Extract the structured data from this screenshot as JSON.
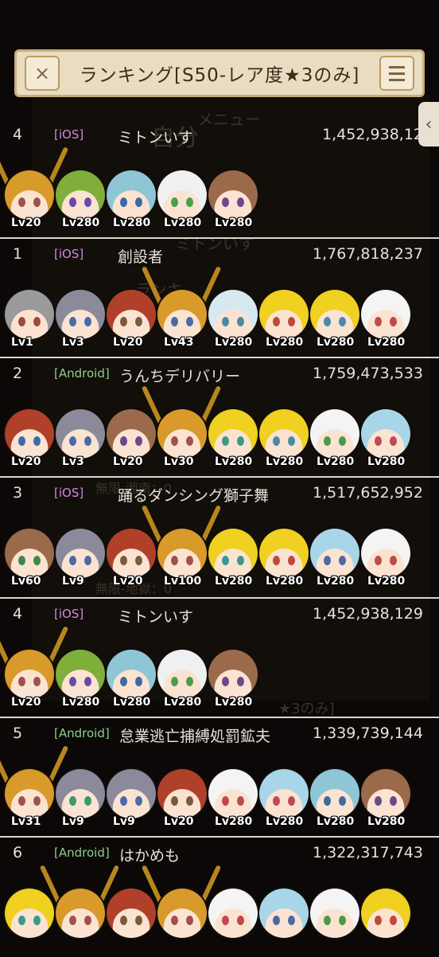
{
  "header": {
    "title": "ランキング[S50-レア度★3のみ]",
    "close_icon": "×",
    "menu_icon": "hamburger-menu"
  },
  "side_tab_icon": "‹",
  "background_texts": [
    "自分",
    "メニュー",
    "ランキ",
    "ミトンいす",
    "無限-湘南：0",
    "無限-地獄：0",
    "★3のみ]"
  ],
  "colors": {
    "ios": "#d08ae0",
    "android": "#8fcf8f",
    "text": "#e6e2da",
    "separator": "#dcd6cc",
    "header_bg": "#eadcc0"
  },
  "rankings": [
    {
      "rank": "4",
      "platform": "[iOS]",
      "platform_type": "ios",
      "name": "ミトンいす",
      "score": "1,452,938,12",
      "units": [
        {
          "level": "Lv20",
          "hair": "#d89a2a",
          "eye": "#a0524a",
          "antler": true
        },
        {
          "level": "Lv280",
          "hair": "#7fae3a",
          "eye": "#6a4aa8"
        },
        {
          "level": "Lv280",
          "hair": "#8fc6d6",
          "eye": "#3f6aa0"
        },
        {
          "level": "Lv280",
          "hair": "#f0f0f0",
          "eye": "#4aa04a"
        },
        {
          "level": "Lv280",
          "hair": "#9a6a4a",
          "eye": "#6a4a8a"
        }
      ]
    },
    {
      "rank": "1",
      "platform": "[iOS]",
      "platform_type": "ios",
      "name": "創設者",
      "score": "1,767,818,237",
      "units": [
        {
          "level": "Lv1",
          "hair": "#9a9a9a",
          "eye": "#a04a3a"
        },
        {
          "level": "Lv3",
          "hair": "#8a8a9a",
          "eye": "#4a6aa8"
        },
        {
          "level": "Lv20",
          "hair": "#b0402a",
          "eye": "#7a5a3a"
        },
        {
          "level": "Lv43",
          "hair": "#d89a2a",
          "eye": "#4a6aa8",
          "antler": true
        },
        {
          "level": "Lv280",
          "hair": "#d8e8f0",
          "eye": "#4a8aa8"
        },
        {
          "level": "Lv280",
          "hair": "#f0d020",
          "eye": "#c04a3a"
        },
        {
          "level": "Lv280",
          "hair": "#f0d020",
          "eye": "#4a8aa8"
        },
        {
          "level": "Lv280",
          "hair": "#f4f4f4",
          "eye": "#c04a4a"
        }
      ]
    },
    {
      "rank": "2",
      "platform": "[Android]",
      "platform_type": "android",
      "name": "うんちデリバリー",
      "score": "1,759,473,533",
      "units": [
        {
          "level": "Lv20",
          "hair": "#b0402a",
          "eye": "#3a6aa8"
        },
        {
          "level": "Lv3",
          "hair": "#8a8a9a",
          "eye": "#4a6aa8"
        },
        {
          "level": "Lv20",
          "hair": "#9a6a4a",
          "eye": "#6a4a8a"
        },
        {
          "level": "Lv30",
          "hair": "#d89a2a",
          "eye": "#a0524a",
          "antler": true
        },
        {
          "level": "Lv280",
          "hair": "#f0d020",
          "eye": "#3a9a8a"
        },
        {
          "level": "Lv280",
          "hair": "#f0d020",
          "eye": "#4a8aa8"
        },
        {
          "level": "Lv280",
          "hair": "#f4f4f4",
          "eye": "#4a9a4a"
        },
        {
          "level": "Lv280",
          "hair": "#a8d6e8",
          "eye": "#c04a5a"
        }
      ]
    },
    {
      "rank": "3",
      "platform": "[iOS]",
      "platform_type": "ios",
      "name": "踊るダンシング獅子舞",
      "score": "1,517,652,952",
      "units": [
        {
          "level": "Lv60",
          "hair": "#9a6a4a",
          "eye": "#3a8a4a"
        },
        {
          "level": "Lv9",
          "hair": "#8a8a9a",
          "eye": "#4a6aa8"
        },
        {
          "level": "Lv20",
          "hair": "#b0402a",
          "eye": "#7a5a3a"
        },
        {
          "level": "Lv100",
          "hair": "#d89a2a",
          "eye": "#a0524a",
          "antler": true
        },
        {
          "level": "Lv280",
          "hair": "#f0d020",
          "eye": "#3a9a8a"
        },
        {
          "level": "Lv280",
          "hair": "#f0d020",
          "eye": "#c04a3a"
        },
        {
          "level": "Lv280",
          "hair": "#a8d6e8",
          "eye": "#4a6aa8"
        },
        {
          "level": "Lv280",
          "hair": "#f4f4f4",
          "eye": "#c04a4a"
        }
      ]
    },
    {
      "rank": "4",
      "platform": "[iOS]",
      "platform_type": "ios",
      "name": "ミトンいす",
      "score": "1,452,938,129",
      "units": [
        {
          "level": "Lv20",
          "hair": "#d89a2a",
          "eye": "#a0524a",
          "antler": true
        },
        {
          "level": "Lv280",
          "hair": "#7fae3a",
          "eye": "#6a4aa8"
        },
        {
          "level": "Lv280",
          "hair": "#8fc6d6",
          "eye": "#3f6aa0"
        },
        {
          "level": "Lv280",
          "hair": "#f0f0f0",
          "eye": "#4aa04a"
        },
        {
          "level": "Lv280",
          "hair": "#9a6a4a",
          "eye": "#6a4a8a"
        }
      ]
    },
    {
      "rank": "5",
      "platform": "[Android]",
      "platform_type": "android",
      "name": "怠業逃亡捕縛処罰鉱夫",
      "score": "1,339,739,144",
      "units": [
        {
          "level": "Lv31",
          "hair": "#d89a2a",
          "eye": "#a0524a",
          "antler": true
        },
        {
          "level": "Lv9",
          "hair": "#8a8a9a",
          "eye": "#3a9a6a"
        },
        {
          "level": "Lv9",
          "hair": "#8a8a9a",
          "eye": "#4a6aa8"
        },
        {
          "level": "Lv20",
          "hair": "#b0402a",
          "eye": "#7a5a3a"
        },
        {
          "level": "Lv280",
          "hair": "#f4f4f4",
          "eye": "#c04a4a"
        },
        {
          "level": "Lv280",
          "hair": "#a8d6e8",
          "eye": "#c04a5a"
        },
        {
          "level": "Lv280",
          "hair": "#8fc6d6",
          "eye": "#3f6aa0"
        },
        {
          "level": "Lv280",
          "hair": "#9a6a4a",
          "eye": "#6a4a8a"
        }
      ]
    },
    {
      "rank": "6",
      "platform": "[Android]",
      "platform_type": "android",
      "name": "はかめも",
      "score": "1,322,317,743",
      "units": [
        {
          "level": "",
          "hair": "#f0d020",
          "eye": "#3a9a8a"
        },
        {
          "level": "",
          "hair": "#d89a2a",
          "eye": "#a0524a",
          "antler": true
        },
        {
          "level": "",
          "hair": "#b0402a",
          "eye": "#7a5a3a"
        },
        {
          "level": "",
          "hair": "#d89a2a",
          "eye": "#a0524a",
          "antler": true
        },
        {
          "level": "",
          "hair": "#f4f4f4",
          "eye": "#c04a4a"
        },
        {
          "level": "",
          "hair": "#a8d6e8",
          "eye": "#4a6aa8"
        },
        {
          "level": "",
          "hair": "#f4f4f4",
          "eye": "#4a9a4a"
        },
        {
          "level": "",
          "hair": "#f0d020",
          "eye": "#c04a3a"
        }
      ]
    }
  ]
}
